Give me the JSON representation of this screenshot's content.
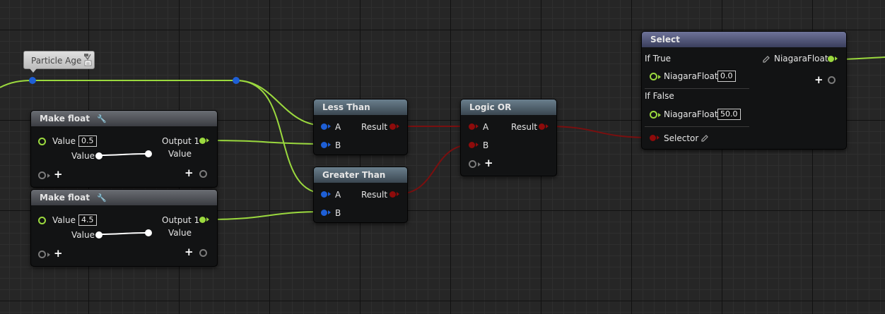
{
  "comment": {
    "text": "Particle Age",
    "icons": [
      "pushpin-icon",
      "note-icon"
    ]
  },
  "nodes": {
    "make_float_1": {
      "title": "Make float",
      "title_icon": "wrench-icon",
      "input_label": "Value",
      "input_value": "0.5",
      "slider_label": "Value",
      "output_label": "Output 1",
      "output_sub_label": "Value"
    },
    "make_float_2": {
      "title": "Make float",
      "title_icon": "wrench-icon",
      "input_label": "Value",
      "input_value": "4.5",
      "slider_label": "Value",
      "output_label": "Output 1",
      "output_sub_label": "Value"
    },
    "less_than": {
      "title": "Less Than",
      "pin_a": "A",
      "pin_b": "B",
      "result": "Result"
    },
    "greater_than": {
      "title": "Greater Than",
      "pin_a": "A",
      "pin_b": "B",
      "result": "Result"
    },
    "logic_or": {
      "title": "Logic OR",
      "pin_a": "A",
      "pin_b": "B",
      "result": "Result"
    },
    "select": {
      "title": "Select",
      "if_true_label": "If True",
      "if_true_pin": "NiagaraFloat",
      "if_true_value": "0.0",
      "if_false_label": "If False",
      "if_false_pin": "NiagaraFloat",
      "if_false_value": "50.0",
      "selector_label": "Selector",
      "output_label": "NiagaraFloat"
    }
  },
  "colors": {
    "float_pin": "#9bd93e",
    "vector_pin": "#1e5fd6",
    "bool_pin": "#8e0b0b",
    "background": "#262626"
  }
}
